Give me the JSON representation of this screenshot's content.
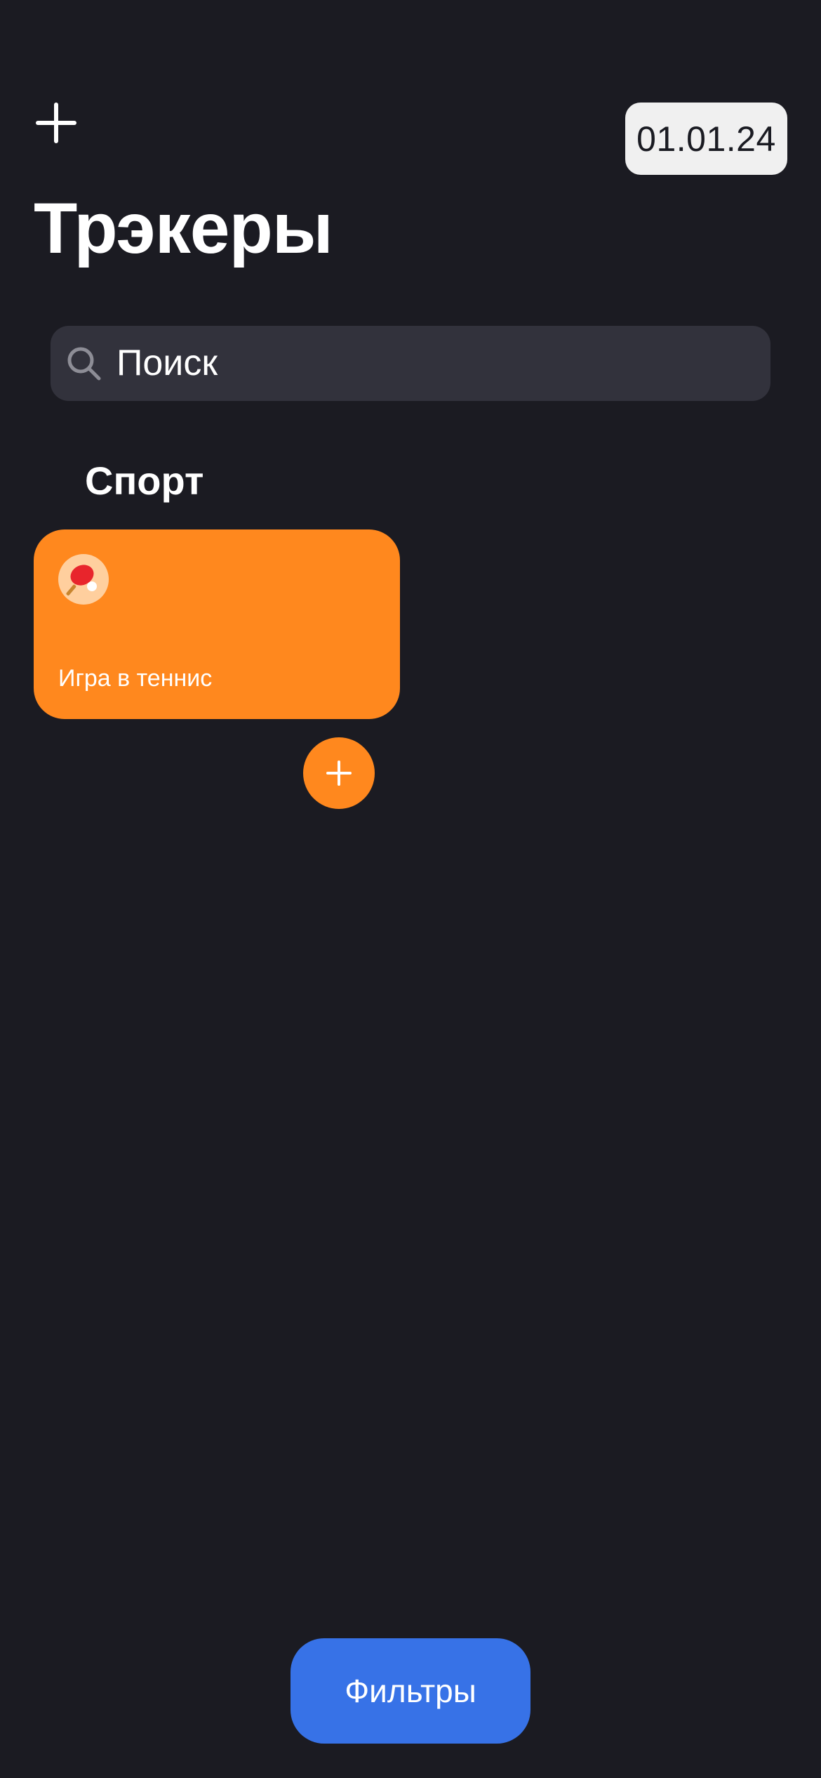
{
  "header": {
    "add_icon": "plus-icon",
    "date": "01.01.24",
    "title": "Трэкеры"
  },
  "search": {
    "icon": "magnifying-glass-icon",
    "placeholder": "Поиск"
  },
  "categories": [
    {
      "title": "Спорт",
      "trackers": [
        {
          "name": "Игра в теннис",
          "emoji": "ping-pong-paddle-icon",
          "color": "#FF881E"
        }
      ],
      "action_icon": "plus-icon"
    }
  ],
  "footer": {
    "filters_label": "Фильтры",
    "filters_color": "#3772E7"
  },
  "colors": {
    "background": "#1B1B22",
    "search_background": "#32323C",
    "date_chip": "#F0F0F0",
    "accent": "#FF881E"
  }
}
